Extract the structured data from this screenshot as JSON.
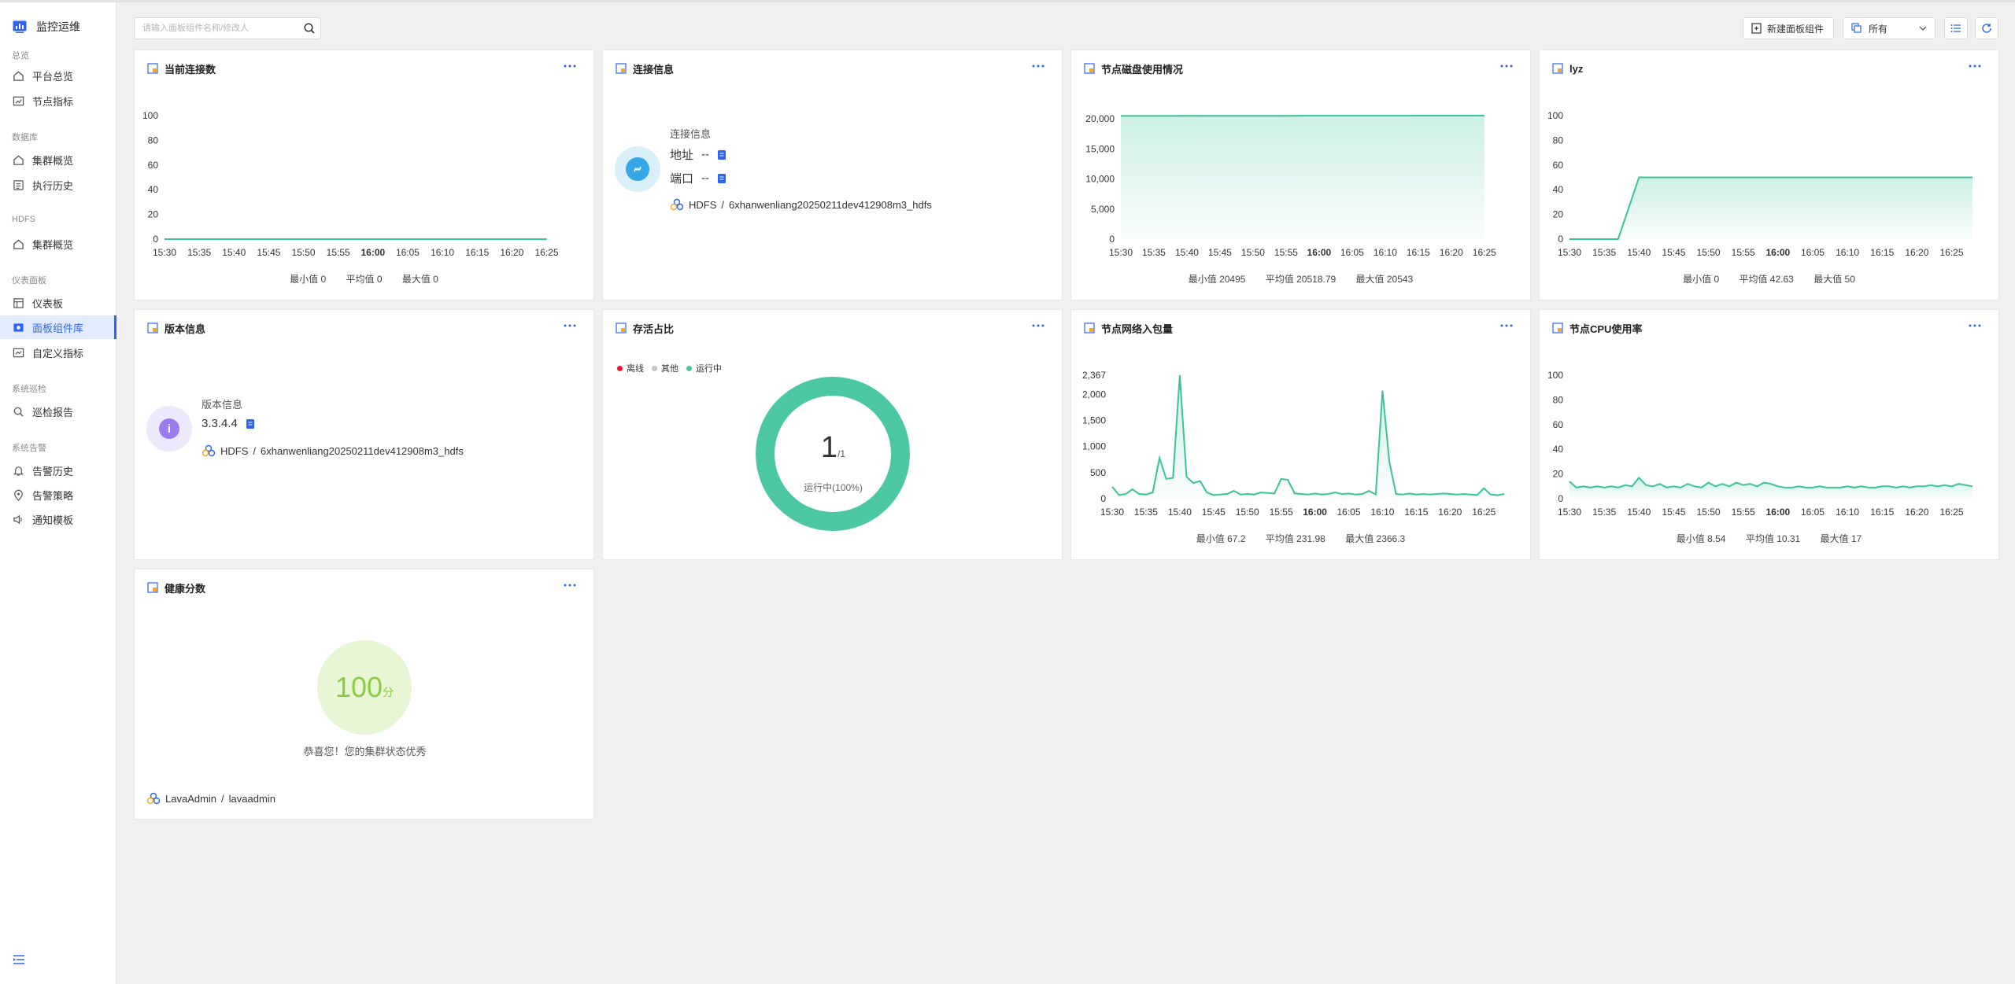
{
  "sidebar": {
    "brand": "监控运维",
    "sections": [
      {
        "title": "总览",
        "items": [
          "平台总览",
          "节点指标"
        ]
      },
      {
        "title": "数据库",
        "items": [
          "集群概览",
          "执行历史"
        ]
      },
      {
        "title": "HDFS",
        "items": [
          "集群概览"
        ]
      },
      {
        "title": "仪表面板",
        "items": [
          "仪表板",
          "面板组件库",
          "自定义指标"
        ]
      },
      {
        "title": "系统巡检",
        "items": [
          "巡检报告"
        ]
      },
      {
        "title": "系统告警",
        "items": [
          "告警历史",
          "告警策略",
          "通知模板"
        ]
      }
    ],
    "active_item": "面板组件库"
  },
  "toolbar": {
    "search_placeholder": "请输入面板组件名称/修改人",
    "new_button": "新建面板组件",
    "filter_value": "所有"
  },
  "x_ticks": [
    "15:30",
    "15:35",
    "15:40",
    "15:45",
    "15:50",
    "15:55",
    "16:00",
    "16:05",
    "16:10",
    "16:15",
    "16:20",
    "16:25"
  ],
  "cards": {
    "connections": {
      "title": "当前连接数",
      "stats": {
        "min": "最小值 0",
        "avg": "平均值 0",
        "max": "最大值 0"
      }
    },
    "conn_info": {
      "title": "连接信息",
      "heading": "连接信息",
      "addr_label": "地址",
      "addr_value": "--",
      "port_label": "端口",
      "port_value": "--",
      "path_type": "HDFS",
      "path_sep": "/",
      "path_name": "6xhanwenliang20250211dev412908m3_hdfs"
    },
    "disk": {
      "title": "节点磁盘使用情况",
      "stats": {
        "min": "最小值 20495",
        "avg": "平均值 20518.79",
        "max": "最大值 20543"
      }
    },
    "lyz": {
      "title": "lyz",
      "stats": {
        "min": "最小值 0",
        "avg": "平均值 42.63",
        "max": "最大值 50"
      }
    },
    "version": {
      "title": "版本信息",
      "heading": "版本信息",
      "value": "3.3.4.4",
      "path_type": "HDFS",
      "path_sep": "/",
      "path_name": "6xhanwenliang20250211dev412908m3_hdfs"
    },
    "alive": {
      "title": "存活占比",
      "legend": [
        "离线",
        "其他",
        "运行中"
      ],
      "legend_colors": [
        "#e8173a",
        "#c5c5c5",
        "#4cc7a4"
      ],
      "count": "1",
      "total": "/1",
      "status": "运行中(100%)"
    },
    "network": {
      "title": "节点网络入包量",
      "stats": {
        "min": "最小值 67.2",
        "avg": "平均值 231.98",
        "max": "最大值 2366.3"
      }
    },
    "cpu": {
      "title": "节点CPU使用率",
      "stats": {
        "min": "最小值 8.54",
        "avg": "平均值 10.31",
        "max": "最大值 17"
      }
    },
    "health": {
      "title": "健康分数",
      "score": "100",
      "unit": "分",
      "message": "恭喜您！您的集群状态优秀",
      "user": "LavaAdmin",
      "sep": "/",
      "user_id": "lavaadmin"
    }
  },
  "chart_data": [
    {
      "type": "line",
      "title": "当前连接数",
      "x": [
        "15:30",
        "15:35",
        "15:40",
        "15:45",
        "15:50",
        "15:55",
        "16:00",
        "16:05",
        "16:10",
        "16:15",
        "16:20",
        "16:25"
      ],
      "series": [
        {
          "values": [
            0,
            0,
            0,
            0,
            0,
            0,
            0,
            0,
            0,
            0,
            0,
            0
          ]
        }
      ],
      "yticks": [
        0,
        20,
        40,
        60,
        80,
        100
      ],
      "ylim": [
        0,
        100
      ]
    },
    {
      "type": "area",
      "title": "节点磁盘使用情况",
      "x": [
        "15:30",
        "15:35",
        "15:40",
        "15:45",
        "15:50",
        "15:55",
        "16:00",
        "16:05",
        "16:10",
        "16:15",
        "16:20",
        "16:25"
      ],
      "series": [
        {
          "values": [
            20495,
            20500,
            20505,
            20510,
            20515,
            20518,
            20520,
            20525,
            20530,
            20535,
            20540,
            20543
          ]
        }
      ],
      "yticks": [
        0,
        5000,
        10000,
        15000,
        20000
      ],
      "ytick_labels": [
        "0",
        "5,000",
        "10,000",
        "15,000",
        "20,000"
      ],
      "ylim": [
        0,
        20543
      ]
    },
    {
      "type": "area",
      "title": "lyz",
      "x": [
        "15:30",
        "15:33",
        "15:37",
        "15:40",
        "15:45",
        "15:50",
        "15:55",
        "16:00",
        "16:05",
        "16:10",
        "16:15",
        "16:20",
        "16:25",
        "16:28"
      ],
      "series": [
        {
          "values": [
            0,
            0,
            0,
            50,
            50,
            50,
            50,
            50,
            50,
            50,
            50,
            50,
            50,
            50
          ]
        }
      ],
      "yticks": [
        0,
        20,
        40,
        60,
        80,
        100
      ],
      "ylim": [
        0,
        100
      ]
    },
    {
      "type": "pie",
      "title": "存活占比",
      "categories": [
        "离线",
        "其他",
        "运行中"
      ],
      "values": [
        0,
        0,
        1
      ]
    },
    {
      "type": "area",
      "title": "节点网络入包量",
      "x": [
        "15:30",
        "15:31",
        "15:32",
        "15:33",
        "15:34",
        "15:35",
        "15:36",
        "15:37",
        "15:38",
        "15:39",
        "15:40",
        "15:41",
        "15:42",
        "15:43",
        "15:44",
        "15:45",
        "15:46",
        "15:47",
        "15:48",
        "15:49",
        "15:50",
        "15:51",
        "15:52",
        "15:53",
        "15:54",
        "15:55",
        "15:56",
        "15:57",
        "15:58",
        "15:59",
        "16:00",
        "16:01",
        "16:02",
        "16:03",
        "16:04",
        "16:05",
        "16:06",
        "16:07",
        "16:08",
        "16:09",
        "16:10",
        "16:11",
        "16:12",
        "16:13",
        "16:14",
        "16:15",
        "16:16",
        "16:17",
        "16:18",
        "16:19",
        "16:20",
        "16:21",
        "16:22",
        "16:23",
        "16:24",
        "16:25",
        "16:26",
        "16:27",
        "16:28"
      ],
      "series": [
        {
          "values": [
            230,
            70,
            90,
            180,
            90,
            80,
            120,
            780,
            380,
            400,
            2366,
            420,
            300,
            340,
            120,
            70,
            80,
            90,
            150,
            80,
            90,
            80,
            120,
            110,
            100,
            380,
            360,
            100,
            90,
            80,
            100,
            80,
            90,
            120,
            90,
            100,
            80,
            90,
            150,
            80,
            2070,
            720,
            90,
            80,
            100,
            80,
            90,
            80,
            90,
            100,
            90,
            80,
            90,
            80,
            70,
            200,
            80,
            67,
            90
          ]
        }
      ],
      "yticks": [
        0,
        500,
        1000,
        1500,
        2000,
        2367
      ],
      "ytick_labels": [
        "0",
        "500",
        "1,000",
        "1,500",
        "2,000",
        "2,367"
      ],
      "ylim": [
        0,
        2367
      ]
    },
    {
      "type": "area",
      "title": "节点CPU使用率",
      "x": [
        "15:30",
        "15:31",
        "15:32",
        "15:33",
        "15:34",
        "15:35",
        "15:36",
        "15:37",
        "15:38",
        "15:39",
        "15:40",
        "15:41",
        "15:42",
        "15:43",
        "15:44",
        "15:45",
        "15:46",
        "15:47",
        "15:48",
        "15:49",
        "15:50",
        "15:51",
        "15:52",
        "15:53",
        "15:54",
        "15:55",
        "15:56",
        "15:57",
        "15:58",
        "15:59",
        "16:00",
        "16:01",
        "16:02",
        "16:03",
        "16:04",
        "16:05",
        "16:06",
        "16:07",
        "16:08",
        "16:09",
        "16:10",
        "16:11",
        "16:12",
        "16:13",
        "16:14",
        "16:15",
        "16:16",
        "16:17",
        "16:18",
        "16:19",
        "16:20",
        "16:21",
        "16:22",
        "16:23",
        "16:24",
        "16:25",
        "16:26",
        "16:27",
        "16:28"
      ],
      "series": [
        {
          "values": [
            14,
            9,
            10,
            9,
            10,
            9,
            10,
            9,
            11,
            10,
            17,
            11,
            10,
            12,
            9,
            10,
            9,
            12,
            10,
            9,
            13,
            10,
            12,
            10,
            13,
            11,
            12,
            10,
            13,
            12,
            10,
            9,
            9,
            10,
            9,
            9,
            10,
            9,
            9,
            9,
            10,
            9,
            10,
            9,
            9,
            10,
            10,
            9,
            10,
            9,
            10,
            10,
            11,
            10,
            11,
            10,
            12,
            11,
            10
          ]
        }
      ],
      "yticks": [
        0,
        20,
        40,
        60,
        80,
        100
      ],
      "ylim": [
        0,
        100
      ]
    }
  ]
}
